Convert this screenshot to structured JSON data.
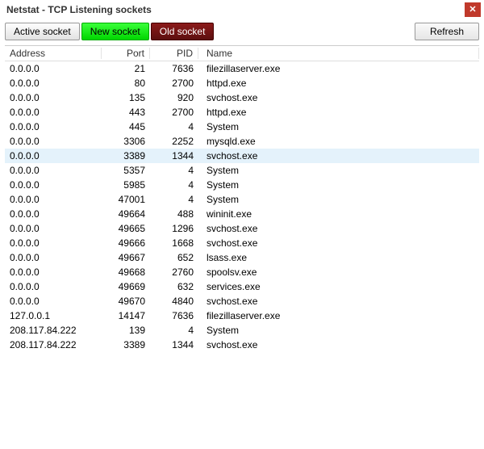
{
  "window": {
    "title": "Netstat - TCP Listening sockets",
    "close_glyph": "✕"
  },
  "tabs": {
    "active": "Active socket",
    "new": "New socket",
    "old": "Old socket"
  },
  "buttons": {
    "refresh": "Refresh"
  },
  "columns": {
    "address": "Address",
    "port": "Port",
    "pid": "PID",
    "name": "Name"
  },
  "selected_index": 6,
  "rows": [
    {
      "address": "0.0.0.0",
      "port": "21",
      "pid": "7636",
      "name": "filezillaserver.exe"
    },
    {
      "address": "0.0.0.0",
      "port": "80",
      "pid": "2700",
      "name": "httpd.exe"
    },
    {
      "address": "0.0.0.0",
      "port": "135",
      "pid": "920",
      "name": "svchost.exe"
    },
    {
      "address": "0.0.0.0",
      "port": "443",
      "pid": "2700",
      "name": "httpd.exe"
    },
    {
      "address": "0.0.0.0",
      "port": "445",
      "pid": "4",
      "name": "System"
    },
    {
      "address": "0.0.0.0",
      "port": "3306",
      "pid": "2252",
      "name": "mysqld.exe"
    },
    {
      "address": "0.0.0.0",
      "port": "3389",
      "pid": "1344",
      "name": "svchost.exe"
    },
    {
      "address": "0.0.0.0",
      "port": "5357",
      "pid": "4",
      "name": "System"
    },
    {
      "address": "0.0.0.0",
      "port": "5985",
      "pid": "4",
      "name": "System"
    },
    {
      "address": "0.0.0.0",
      "port": "47001",
      "pid": "4",
      "name": "System"
    },
    {
      "address": "0.0.0.0",
      "port": "49664",
      "pid": "488",
      "name": "wininit.exe"
    },
    {
      "address": "0.0.0.0",
      "port": "49665",
      "pid": "1296",
      "name": "svchost.exe"
    },
    {
      "address": "0.0.0.0",
      "port": "49666",
      "pid": "1668",
      "name": "svchost.exe"
    },
    {
      "address": "0.0.0.0",
      "port": "49667",
      "pid": "652",
      "name": "lsass.exe"
    },
    {
      "address": "0.0.0.0",
      "port": "49668",
      "pid": "2760",
      "name": "spoolsv.exe"
    },
    {
      "address": "0.0.0.0",
      "port": "49669",
      "pid": "632",
      "name": "services.exe"
    },
    {
      "address": "0.0.0.0",
      "port": "49670",
      "pid": "4840",
      "name": "svchost.exe"
    },
    {
      "address": "127.0.0.1",
      "port": "14147",
      "pid": "7636",
      "name": "filezillaserver.exe"
    },
    {
      "address": "208.117.84.222",
      "port": "139",
      "pid": "4",
      "name": "System"
    },
    {
      "address": "208.117.84.222",
      "port": "3389",
      "pid": "1344",
      "name": "svchost.exe"
    }
  ]
}
